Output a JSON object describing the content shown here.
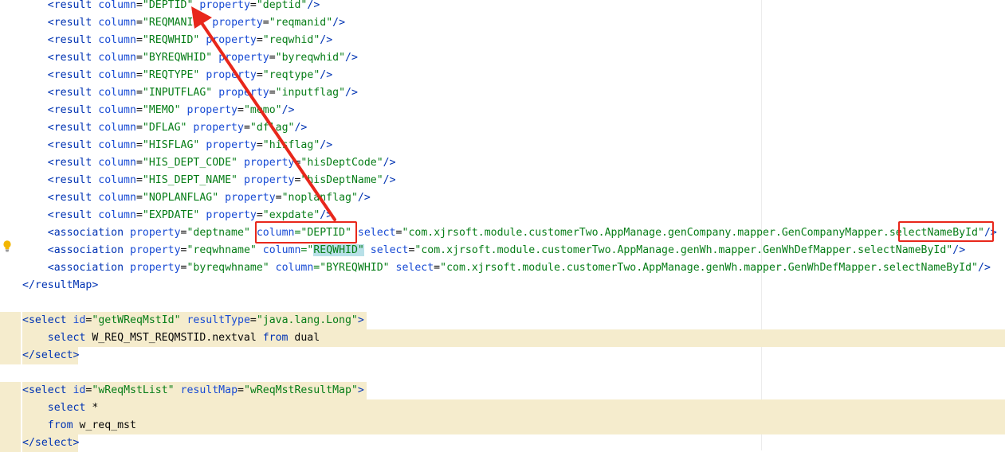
{
  "colors": {
    "tag": "#0033b3",
    "attribute": "#174ad4",
    "string": "#067d17",
    "annotation": "#e8271b",
    "highlight": "#f5eccd"
  },
  "results": [
    {
      "column": "DEPTID",
      "property": "deptid"
    },
    {
      "column": "REQMANID",
      "property": "reqmanid"
    },
    {
      "column": "REQWHID",
      "property": "reqwhid"
    },
    {
      "column": "BYREQWHID",
      "property": "byreqwhid"
    },
    {
      "column": "REQTYPE",
      "property": "reqtype"
    },
    {
      "column": "INPUTFLAG",
      "property": "inputflag"
    },
    {
      "column": "MEMO",
      "property": "memo"
    },
    {
      "column": "DFLAG",
      "property": "dflag"
    },
    {
      "column": "HISFLAG",
      "property": "hisflag"
    },
    {
      "column": "HIS_DEPT_CODE",
      "property": "hisDeptCode"
    },
    {
      "column": "HIS_DEPT_NAME",
      "property": "hisDeptName"
    },
    {
      "column": "NOPLANFLAG",
      "property": "noplanflag"
    },
    {
      "column": "EXPDATE",
      "property": "expdate"
    }
  ],
  "associations": [
    {
      "property": "deptname",
      "column": "DEPTID",
      "select_prefix": "com.xjrsoft.module.customerTwo.AppManage.genCompany.mapper.GenCompanyMapper.",
      "select_method": "selectNameById"
    },
    {
      "property": "reqwhname",
      "column": "REQWHID",
      "select_prefix": "com.xjrsoft.module.customerTwo.AppManage.genWh.mapper.GenWhDefMapper.",
      "select_method": "selectNameById"
    },
    {
      "property": "byreqwhname",
      "column": "BYREQWHID",
      "select_prefix": "com.xjrsoft.module.customerTwo.AppManage.genWh.mapper.GenWhDefMapper.",
      "select_method": "selectNameById"
    }
  ],
  "result_map_close": "resultMap",
  "select1": {
    "id": "getWReqMstId",
    "result_type": "java.lang.Long",
    "body_keyword": "select",
    "body_seq": "W_REQ_MST_REQMSTID.nextval",
    "body_from": "from",
    "body_table": "dual"
  },
  "select2": {
    "id": "wReqMstList",
    "result_map": "wReqMstResultMap",
    "line1_keyword": "select",
    "line1_rest": "*",
    "line2_keyword": "from",
    "line2_table": "w_req_mst"
  },
  "tokens": {
    "result_tag": "result",
    "association_tag": "association",
    "select_tag": "select",
    "attr_column": "column",
    "attr_property": "property",
    "attr_select": "select",
    "attr_id": "id",
    "attr_result_type": "resultType",
    "attr_result_map": "resultMap"
  }
}
